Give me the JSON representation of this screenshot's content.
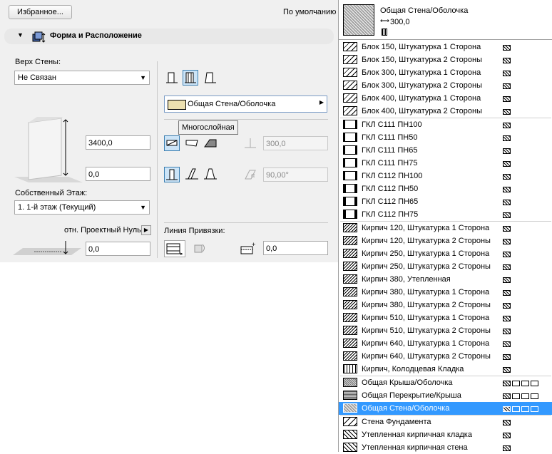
{
  "favorites_button": "Избранное...",
  "default_label": "По умолчанию",
  "section": {
    "title": "Форма и Расположение"
  },
  "top_link": {
    "label": "Верх Стены:",
    "value": "Не Связан"
  },
  "height_value": "3400,0",
  "base_offset_value": "0,0",
  "home_story": {
    "label": "Собственный Этаж:",
    "value": "1. 1-й этаж (Текущий)"
  },
  "project_zero": {
    "label": "отн. Проектный Нуль",
    "value": "0,0"
  },
  "composite": {
    "value": "Общая Стена/Оболочка",
    "tooltip": "Многослойная"
  },
  "thickness_value": "300,0",
  "angle_value": "90,00°",
  "reference_line": {
    "label": "Линия Привязки:",
    "offset_value": "0,0"
  },
  "preview": {
    "name": "Общая Стена/Оболочка",
    "thickness": "300,0"
  },
  "colors": {
    "selection": "#3399ff",
    "panel_bg": "#f0f0f0"
  },
  "list": [
    {
      "name": "Блок 150, Штукатурка 1 Сторона",
      "pattern": "diag"
    },
    {
      "name": "Блок 150, Штукатурка 2 Стороны",
      "pattern": "diag"
    },
    {
      "name": "Блок 300, Штукатурка 1 Сторона",
      "pattern": "diag"
    },
    {
      "name": "Блок 300, Штукатурка 2 Стороны",
      "pattern": "diag"
    },
    {
      "name": "Блок 400, Штукатурка 1 Сторона",
      "pattern": "diag"
    },
    {
      "name": "Блок 400, Штукатурка 2 Стороны",
      "pattern": "diag",
      "sep": true
    },
    {
      "name": "ГКЛ С111 ПН100",
      "pattern": "gkl"
    },
    {
      "name": "ГКЛ С111 ПН50",
      "pattern": "gkl"
    },
    {
      "name": "ГКЛ С111 ПН65",
      "pattern": "gkl"
    },
    {
      "name": "ГКЛ С111 ПН75",
      "pattern": "gkl"
    },
    {
      "name": "ГКЛ С112 ПН100",
      "pattern": "gkl"
    },
    {
      "name": "ГКЛ С112 ПН50",
      "pattern": "gkl2"
    },
    {
      "name": "ГКЛ С112 ПН65",
      "pattern": "gkl2"
    },
    {
      "name": "ГКЛ С112 ПН75",
      "pattern": "gkl2",
      "sep": true
    },
    {
      "name": "Кирпич 120, Штукатурка 1 Сторона",
      "pattern": "brick"
    },
    {
      "name": "Кирпич 120, Штукатурка 2 Стороны",
      "pattern": "brick"
    },
    {
      "name": "Кирпич 250, Штукатурка 1 Сторона",
      "pattern": "brick"
    },
    {
      "name": "Кирпич 250, Штукатурка 2 Стороны",
      "pattern": "brick"
    },
    {
      "name": "Кирпич 380, Утепленная",
      "pattern": "brick"
    },
    {
      "name": "Кирпич 380, Штукатурка 1 Сторона",
      "pattern": "brick"
    },
    {
      "name": "Кирпич 380, Штукатурка 2 Стороны",
      "pattern": "brick"
    },
    {
      "name": "Кирпич 510, Штукатурка 1 Сторона",
      "pattern": "brick"
    },
    {
      "name": "Кирпич 510, Штукатурка 2 Стороны",
      "pattern": "brick"
    },
    {
      "name": "Кирпич 640, Штукатурка 1 Сторона",
      "pattern": "brick"
    },
    {
      "name": "Кирпич 640, Штукатурка 2 Стороны",
      "pattern": "brick"
    },
    {
      "name": "Кирпич, Колодцевая Кладка",
      "pattern": "well",
      "sep": true
    },
    {
      "name": "Общая Крыша/Оболочка",
      "pattern": "dots",
      "multi": true
    },
    {
      "name": "Общая Перекрытие/Крыша",
      "pattern": "dots2",
      "multi": true
    },
    {
      "name": "Общая Стена/Оболочка",
      "pattern": "dots3",
      "multi": true,
      "selected": true,
      "sep": true
    },
    {
      "name": "Стена Фундамента",
      "pattern": "found"
    },
    {
      "name": "Утепленная кирпичная кладка",
      "pattern": "ins"
    },
    {
      "name": "Утепленная кирпичная стена",
      "pattern": "ins"
    }
  ]
}
